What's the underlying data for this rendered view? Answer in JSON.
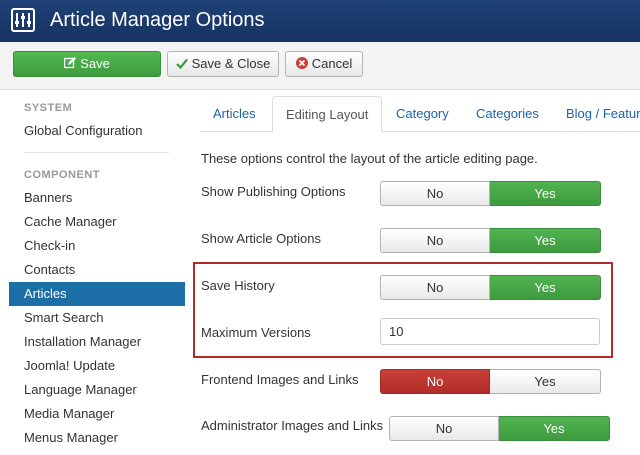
{
  "header": {
    "title": "Article Manager Options",
    "logo_icon": "joomla-options-icon"
  },
  "toolbar": {
    "save_label": "Save",
    "save_close_label": "Save & Close",
    "cancel_label": "Cancel"
  },
  "sidebar": {
    "system_heading": "SYSTEM",
    "global_config": "Global Configuration",
    "component_heading": "COMPONENT",
    "items": [
      "Banners",
      "Cache Manager",
      "Check-in",
      "Contacts",
      "Articles",
      "Smart Search",
      "Installation Manager",
      "Joomla! Update",
      "Language Manager",
      "Media Manager",
      "Menus Manager"
    ],
    "active_item": "Articles"
  },
  "tabs": [
    "Articles",
    "Editing Layout",
    "Category",
    "Categories",
    "Blog / Featur"
  ],
  "active_tab": "Editing Layout",
  "content": {
    "description": "These options control the layout of the article editing page.",
    "fields": {
      "show_publishing": {
        "label": "Show Publishing Options",
        "no": "No",
        "yes": "Yes",
        "value": "Yes"
      },
      "show_article": {
        "label": "Show Article Options",
        "no": "No",
        "yes": "Yes",
        "value": "Yes"
      },
      "save_history": {
        "label": "Save History",
        "no": "No",
        "yes": "Yes",
        "value": "Yes"
      },
      "max_versions": {
        "label": "Maximum Versions",
        "value": "10"
      },
      "frontend_images": {
        "label": "Frontend Images and Links",
        "no": "No",
        "yes": "Yes",
        "value": "No"
      },
      "admin_images": {
        "label": "Administrator Images and Links",
        "no": "No",
        "yes": "Yes",
        "value": "Yes"
      }
    }
  },
  "colors": {
    "header": "#1a3867",
    "success": "#46a546",
    "danger": "#bd362f",
    "active_nav": "#1c6ea6",
    "highlight_box": "#b22a2a"
  }
}
